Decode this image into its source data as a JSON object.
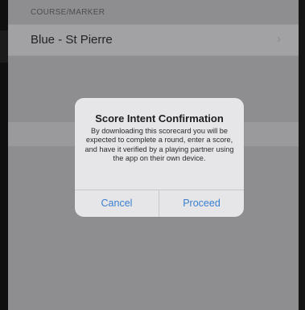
{
  "section": {
    "header": "COURSE/MARKER"
  },
  "course_row": {
    "label": "Blue - St Pierre",
    "chevron": "›"
  },
  "alert": {
    "title": "Score Intent Confirmation",
    "message": "By downloading this scorecard you will be expected to complete a round, enter a score, and have it verified by a playing partner using the app on their own device.",
    "cancel_label": "Cancel",
    "proceed_label": "Proceed",
    "button_color": "#3a7fd0"
  },
  "icons": {
    "chevron": "chevron-right-icon"
  }
}
